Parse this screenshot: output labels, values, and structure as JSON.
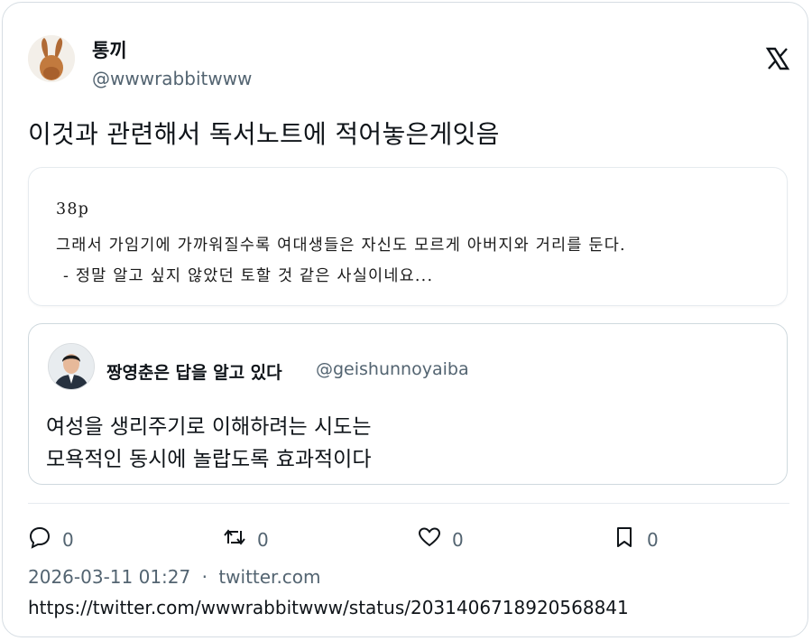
{
  "author": {
    "display_name": "통끼",
    "handle": "@wwwrabbitwww"
  },
  "tweet_text": "이것과 관련해서 독서노트에 적어놓은게잇음",
  "image_note": {
    "page": "38p",
    "line1": "그래서 가임기에 가까워질수록 여대생들은 자신도 모르게 아버지와 거리를 둔다.",
    "line2": "- 정말 알고 싶지 않았던 토할 것 같은 사실이네요..."
  },
  "quoted_tweet": {
    "display_name": "짱영춘은 답을 알고 있다",
    "handle": "@geishunnoyaiba",
    "text_line1": "여성을 생리주기로 이해하려는 시도는",
    "text_line2": "모욕적인 동시에 놀랍도록 효과적이다"
  },
  "actions": {
    "reply_count": "0",
    "retweet_count": "0",
    "like_count": "0",
    "bookmark_count": "0"
  },
  "meta": {
    "timestamp": "2026-03-11 01:27",
    "separator": "·",
    "source": "twitter.com",
    "url": "https://twitter.com/wwwrabbitwww/status/2031406718920568841"
  },
  "icons": [
    "rabbit-avatar-icon",
    "x-logo-icon",
    "reply-icon",
    "retweet-icon",
    "like-icon",
    "bookmark-icon"
  ],
  "colors": {
    "text": "#0f1419",
    "secondary": "#536471",
    "border": "#cfd9de"
  }
}
